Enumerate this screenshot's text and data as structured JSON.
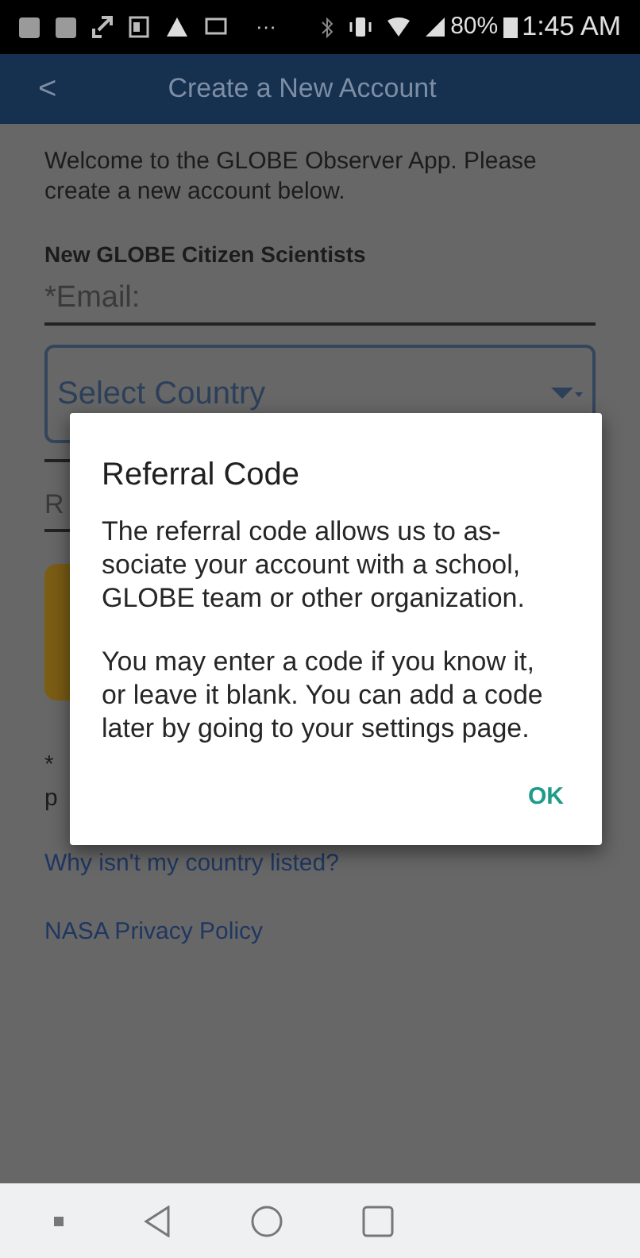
{
  "status_bar": {
    "overflow": "···",
    "battery": "80%",
    "time": "1:45 AM"
  },
  "app_bar": {
    "back": "<",
    "title": "Create a New Account"
  },
  "intro": "Welcome to the GLOBE Observer App. Please create a new account below.",
  "section_title": "New GLOBE Citizen Scientists",
  "email_field": {
    "placeholder": "*Email:"
  },
  "country_select": {
    "placeholder": "Select Country"
  },
  "referral_field": {
    "placeholder": "R"
  },
  "note_lines": [
    "*",
    "p"
  ],
  "links": [
    "Why isn't my country listed?",
    "NASA Privacy Policy"
  ],
  "dialog": {
    "title": "Referral Code",
    "paragraphs": [
      "The referral code allows us to as-sociate your account with a school, GLOBE team or other organization.",
      "You may enter a code if you know it, or leave it blank. You can add a code later by going to your settings page."
    ],
    "button": "OK"
  }
}
